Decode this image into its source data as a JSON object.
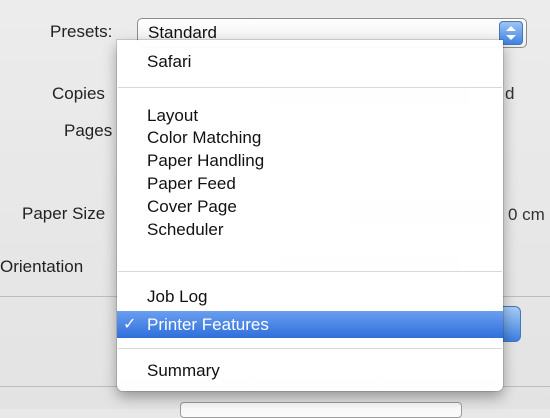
{
  "dialog": {
    "presets_label": "Presets:",
    "presets_value": "Standard",
    "copies_label": "Copies",
    "pages_label": "Pages",
    "paper_size_label": "Paper Size",
    "orientation_label": "Orientation",
    "right_fragment_copies": "d",
    "right_fragment_paper": "0 cm"
  },
  "menu": {
    "items": [
      {
        "label": "Safari"
      },
      {
        "label": "Layout"
      },
      {
        "label": "Color Matching"
      },
      {
        "label": "Paper Handling"
      },
      {
        "label": "Paper Feed"
      },
      {
        "label": "Cover Page"
      },
      {
        "label": "Scheduler"
      },
      {
        "label": "Job Log"
      },
      {
        "label": "Printer Features",
        "checkmark": "✓"
      },
      {
        "label": "Summary"
      }
    ]
  },
  "colors": {
    "selection": "#3b78dd",
    "menu_background": "#ffffff",
    "dialog_background": "#e8e8e8"
  }
}
